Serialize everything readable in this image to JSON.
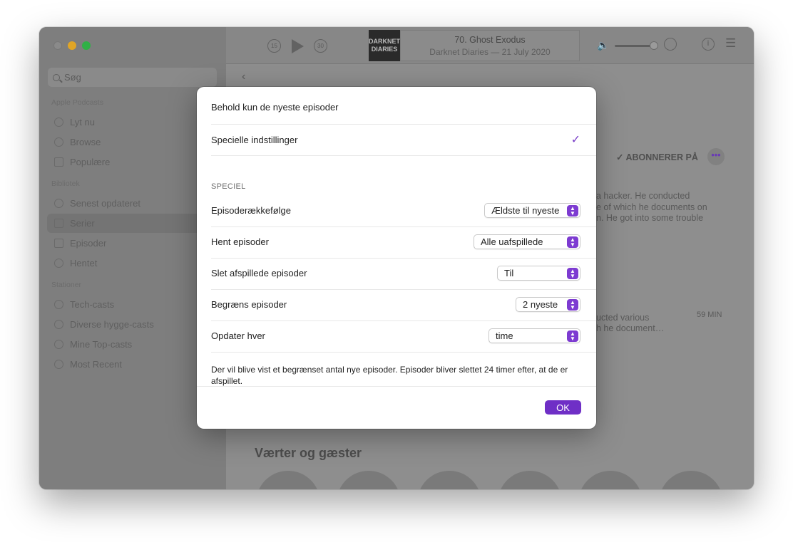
{
  "player": {
    "artwork_line1": "DARKNET",
    "artwork_line2": "DIARIES",
    "skip_back": "15",
    "skip_forward": "30",
    "episode_title": "70. Ghost Exodus",
    "episode_subtitle": "Darknet Diaries — 21 July 2020"
  },
  "sidebar": {
    "search_placeholder": "Søg",
    "sections": [
      {
        "label": "Apple Podcasts",
        "items": [
          "Lyt nu",
          "Browse",
          "Populære"
        ]
      },
      {
        "label": "Bibliotek",
        "items": [
          "Senest opdateret",
          "Serier",
          "Episoder",
          "Hentet"
        ]
      },
      {
        "label": "Stationer",
        "items": [
          "Tech-casts",
          "Diverse hygge-casts",
          "Mine Top-casts",
          "Most Recent"
        ]
      }
    ],
    "active_item": "Serier"
  },
  "main": {
    "subscribe_label": "✓ ABONNERER PÅ",
    "desc_line1": "a hacker. He conducted",
    "desc_line2": "e of which he documents on",
    "desc_line3": "n. He got into some trouble",
    "ep_line1": "ucted various",
    "ep_line2": "h he document…",
    "ep_duration": "59 MIN",
    "hosts_title": "Værter og gæster"
  },
  "dialog": {
    "option_keep_latest": "Behold kun de nyeste episoder",
    "option_custom": "Specielle indstillinger",
    "section_title": "SPECIEL",
    "settings": [
      {
        "label": "Episoderækkefølge",
        "value": "Ældste til nyeste"
      },
      {
        "label": "Hent episoder",
        "value": "Alle uafspillede"
      },
      {
        "label": "Slet afspillede episoder",
        "value": "Til"
      },
      {
        "label": "Begræns episoder",
        "value": "2 nyeste"
      },
      {
        "label": "Opdater hver",
        "value": "time"
      }
    ],
    "note": "Der vil blive vist et begrænset antal nye episoder. Episoder bliver slettet 24 timer efter, at de er afspillet.",
    "ok_label": "OK"
  },
  "colors": {
    "accent": "#7d3bd1"
  }
}
